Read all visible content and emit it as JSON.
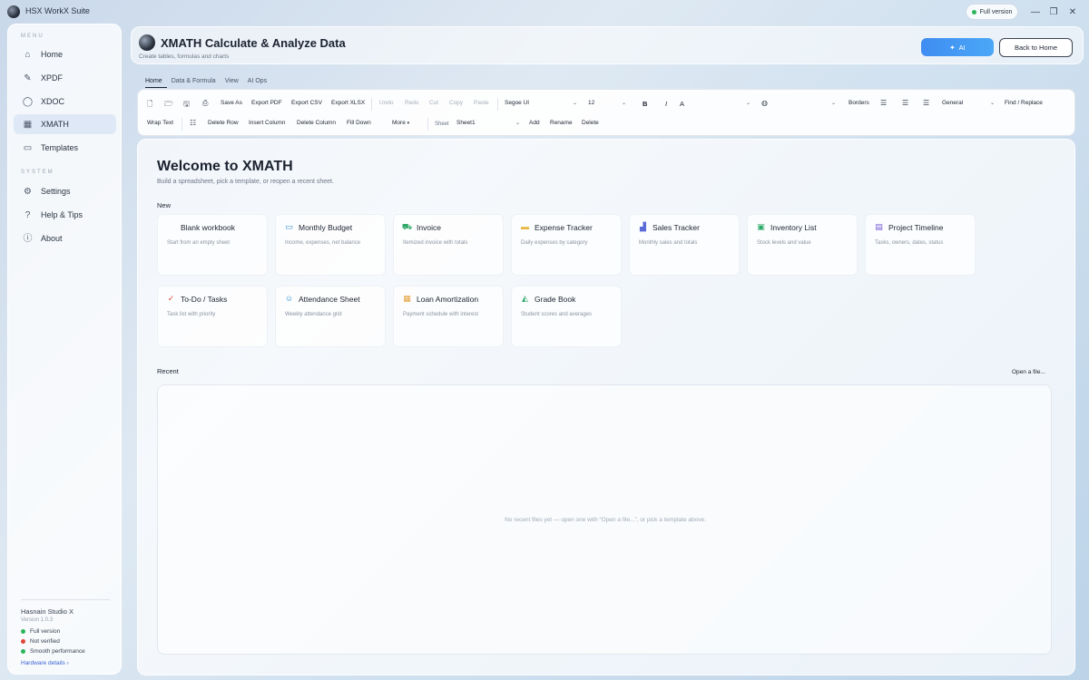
{
  "app": {
    "title": "HSX WorkX Suite",
    "full_version": "Full version"
  },
  "window_controls": {
    "minimize": "—",
    "restore": "❐",
    "close": "✕"
  },
  "sidebar": {
    "menu_label": "MENU",
    "items": [
      {
        "label": "Home",
        "icon": "home-icon",
        "glyph": "⌂"
      },
      {
        "label": "XPDF",
        "icon": "pdf-icon",
        "glyph": "✎"
      },
      {
        "label": "XDOC",
        "icon": "doc-icon",
        "glyph": "◯"
      },
      {
        "label": "XMATH",
        "icon": "table-icon",
        "glyph": "▦",
        "active": true
      },
      {
        "label": "Templates",
        "icon": "templates-icon",
        "glyph": "▭"
      }
    ],
    "system_label": "SYSTEM",
    "system_items": [
      {
        "label": "Settings",
        "icon": "gear-icon",
        "glyph": "⚙"
      },
      {
        "label": "Help & Tips",
        "icon": "help-icon",
        "glyph": "?"
      },
      {
        "label": "About",
        "icon": "info-icon",
        "glyph": "ⓘ"
      }
    ],
    "footer": {
      "studio": "Hasnain Studio X",
      "version": "Version 1.0.3",
      "statuses": [
        {
          "label": "Full version",
          "color": "#2bb55a"
        },
        {
          "label": "Not verified",
          "color": "#e0463b"
        },
        {
          "label": "Smooth performance",
          "color": "#2bb55a"
        }
      ],
      "hardware_link": "Hardware details ›"
    }
  },
  "header": {
    "title": "XMATH Calculate & Analyze Data",
    "subtitle": "Create tables, formulas and charts",
    "ai_button": "AI",
    "back_button": "Back to Home"
  },
  "ribbon": {
    "tabs": [
      "Home",
      "Data & Formula",
      "View",
      "AI Ops"
    ],
    "row1": {
      "save_as": "Save As",
      "export_pdf": "Export PDF",
      "export_csv": "Export CSV",
      "export_xlsx": "Export XLSX",
      "undo": "Undo",
      "redo": "Redo",
      "cut": "Cut",
      "copy": "Copy",
      "paste": "Paste",
      "font": "Segoe UI",
      "size": "12",
      "bold": "B",
      "italic": "I",
      "font_color": "A",
      "borders": "Borders",
      "number_format": "General",
      "find_replace": "Find / Replace"
    },
    "row2": {
      "wrap_text": "Wrap Text",
      "delete_row": "Delete Row",
      "insert_column": "Insert Column",
      "delete_column": "Delete Column",
      "fill_down": "Fill Down",
      "more": "More",
      "sheet_label": "Sheet",
      "sheet": "Sheet1",
      "add": "Add",
      "rename": "Rename",
      "delete": "Delete"
    }
  },
  "main": {
    "welcome": "Welcome to XMATH",
    "welcome_sub": "Build a spreadsheet, pick a template, or reopen a recent sheet.",
    "new_label": "New",
    "templates": [
      {
        "title": "Blank workbook",
        "desc": "Start from an empty sheet",
        "icon": "blank-icon",
        "glyph": "",
        "color": "#1b2230"
      },
      {
        "title": "Monthly Budget",
        "desc": "Income, expenses, net balance",
        "icon": "wallet-icon",
        "glyph": "▭",
        "color": "#2f8fd6"
      },
      {
        "title": "Invoice",
        "desc": "Itemized invoice with totals",
        "icon": "cart-icon",
        "glyph": "⛟",
        "color": "#2fa96a"
      },
      {
        "title": "Expense Tracker",
        "desc": "Daily expenses by category",
        "icon": "card-icon",
        "glyph": "▬",
        "color": "#e6b640"
      },
      {
        "title": "Sales Tracker",
        "desc": "Monthly sales and totals",
        "icon": "chart-icon",
        "glyph": "▟",
        "color": "#5a6bd8"
      },
      {
        "title": "Inventory List",
        "desc": "Stock levels and value",
        "icon": "box-icon",
        "glyph": "▣",
        "color": "#2fa96a"
      },
      {
        "title": "Project Timeline",
        "desc": "Tasks, owners, dates, status",
        "icon": "timeline-icon",
        "glyph": "▤",
        "color": "#7a5bd8"
      },
      {
        "title": "To-Do / Tasks",
        "desc": "Task list with priority",
        "icon": "check-icon",
        "glyph": "✓",
        "color": "#e0463b"
      },
      {
        "title": "Attendance Sheet",
        "desc": "Weekly attendance grid",
        "icon": "people-icon",
        "glyph": "☺",
        "color": "#2f8fd6"
      },
      {
        "title": "Loan Amortization",
        "desc": "Payment schedule with interest",
        "icon": "loan-icon",
        "glyph": "▦",
        "color": "#e6a23c"
      },
      {
        "title": "Grade Book",
        "desc": "Student scores and averages",
        "icon": "graduation-icon",
        "glyph": "◭",
        "color": "#2fa96a"
      }
    ],
    "recent_label": "Recent",
    "open_file": "Open a file...",
    "recent_empty": "No recent files yet — open one with “Open a file...”, or pick a template above."
  }
}
